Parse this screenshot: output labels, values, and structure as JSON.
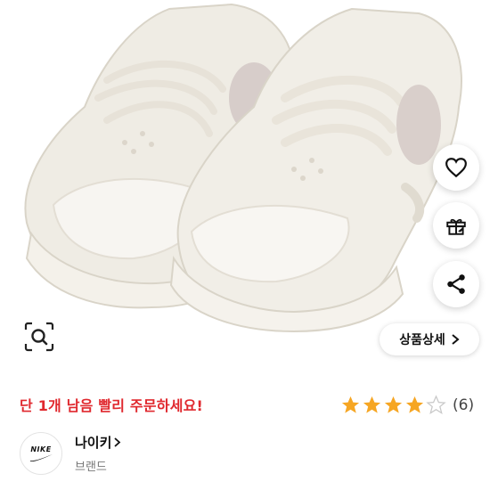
{
  "actions": {
    "wishlist_icon": "heart-icon",
    "gift_icon": "gift-icon",
    "share_icon": "share-icon",
    "lens_icon": "image-search-icon",
    "detail_label": "상품상세"
  },
  "urgency_text": "단 1개 남음 빨리 주문하세요!",
  "rating": {
    "stars": 4,
    "max": 5,
    "count_label": "(6)"
  },
  "brand": {
    "logo_text": "NIKE",
    "name": "나이키",
    "caption": "브랜드"
  },
  "colors": {
    "urgent": "#e0282e",
    "star": "#f6a623"
  }
}
